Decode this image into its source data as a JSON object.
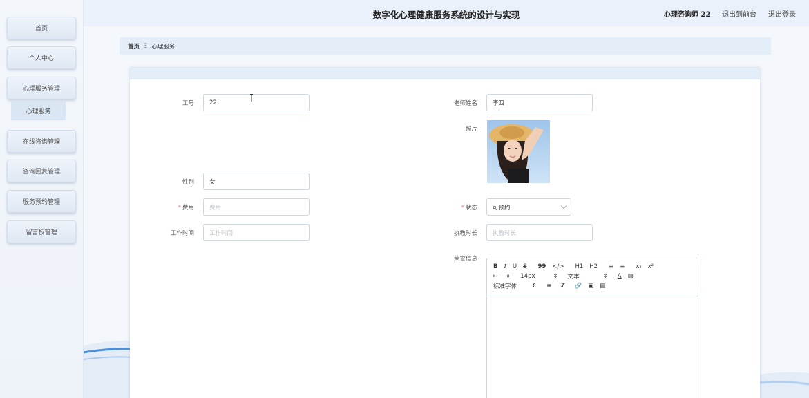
{
  "header": {
    "title": "数字化心理健康服务系统的设计与实现",
    "user": "心理咨询师 22",
    "front_label": "退出到前台",
    "logout_label": "退出登录"
  },
  "sidebar": {
    "items": [
      {
        "label": "首页"
      },
      {
        "label": "个人中心"
      },
      {
        "label": "心理服务管理"
      },
      {
        "label": "在线咨询管理"
      },
      {
        "label": "咨询回复管理"
      },
      {
        "label": "服务预约管理"
      },
      {
        "label": "留言板管理"
      }
    ],
    "submenu": {
      "label": "心理服务"
    }
  },
  "breadcrumb": {
    "home": "首页",
    "separator": "Ξ",
    "current": "心理服务"
  },
  "form": {
    "job_no": {
      "label": "工号",
      "value": "22"
    },
    "teacher_name": {
      "label": "老师姓名",
      "value": "李四"
    },
    "photo": {
      "label": "照片"
    },
    "gender": {
      "label": "性别",
      "value": "女"
    },
    "fee": {
      "label": "费用",
      "placeholder": "费用",
      "required": true
    },
    "status": {
      "label": "状态",
      "value": "可预约",
      "required": true
    },
    "work_time": {
      "label": "工作时间",
      "placeholder": "工作时间"
    },
    "practice_years": {
      "label": "执教时长",
      "placeholder": "执教时长"
    },
    "honor": {
      "label": "荣誉信息"
    }
  },
  "editor": {
    "toolbar_row1": [
      "B",
      "I",
      "U",
      "S",
      "99",
      "</>",
      "H1",
      "H2",
      "≡",
      "≡",
      "x₂",
      "x²"
    ],
    "font_size": "14px",
    "text_style": "文本",
    "font_family": "标准字体"
  }
}
